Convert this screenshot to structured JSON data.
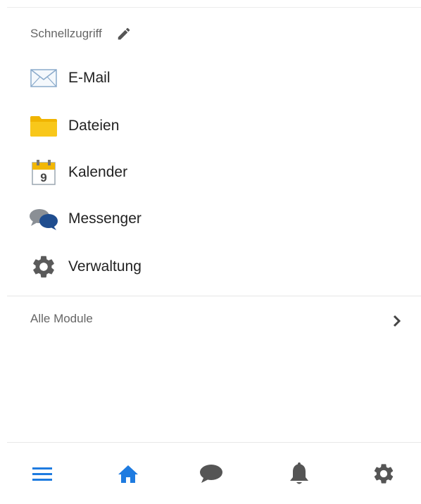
{
  "quick_access": {
    "title": "Schnellzugriff",
    "items": [
      {
        "label": "E-Mail",
        "icon": "envelope-icon"
      },
      {
        "label": "Dateien",
        "icon": "folder-icon"
      },
      {
        "label": "Kalender",
        "icon": "calendar-icon",
        "icon_text": "9"
      },
      {
        "label": "Messenger",
        "icon": "chat-bubbles-icon"
      },
      {
        "label": "Verwaltung",
        "icon": "gear-icon"
      }
    ]
  },
  "all_modules": {
    "label": "Alle Module"
  },
  "bottom_nav": {
    "items": [
      {
        "icon": "menu-icon",
        "active_color": "#1e7be0"
      },
      {
        "icon": "home-icon",
        "active_color": "#1e7be0"
      },
      {
        "icon": "chat-icon"
      },
      {
        "icon": "bell-icon"
      },
      {
        "icon": "settings-icon"
      }
    ]
  },
  "colors": {
    "accent": "#1e7be0",
    "folder": "#f6c10e",
    "icon_gray": "#555555",
    "text_secondary": "#666666"
  }
}
